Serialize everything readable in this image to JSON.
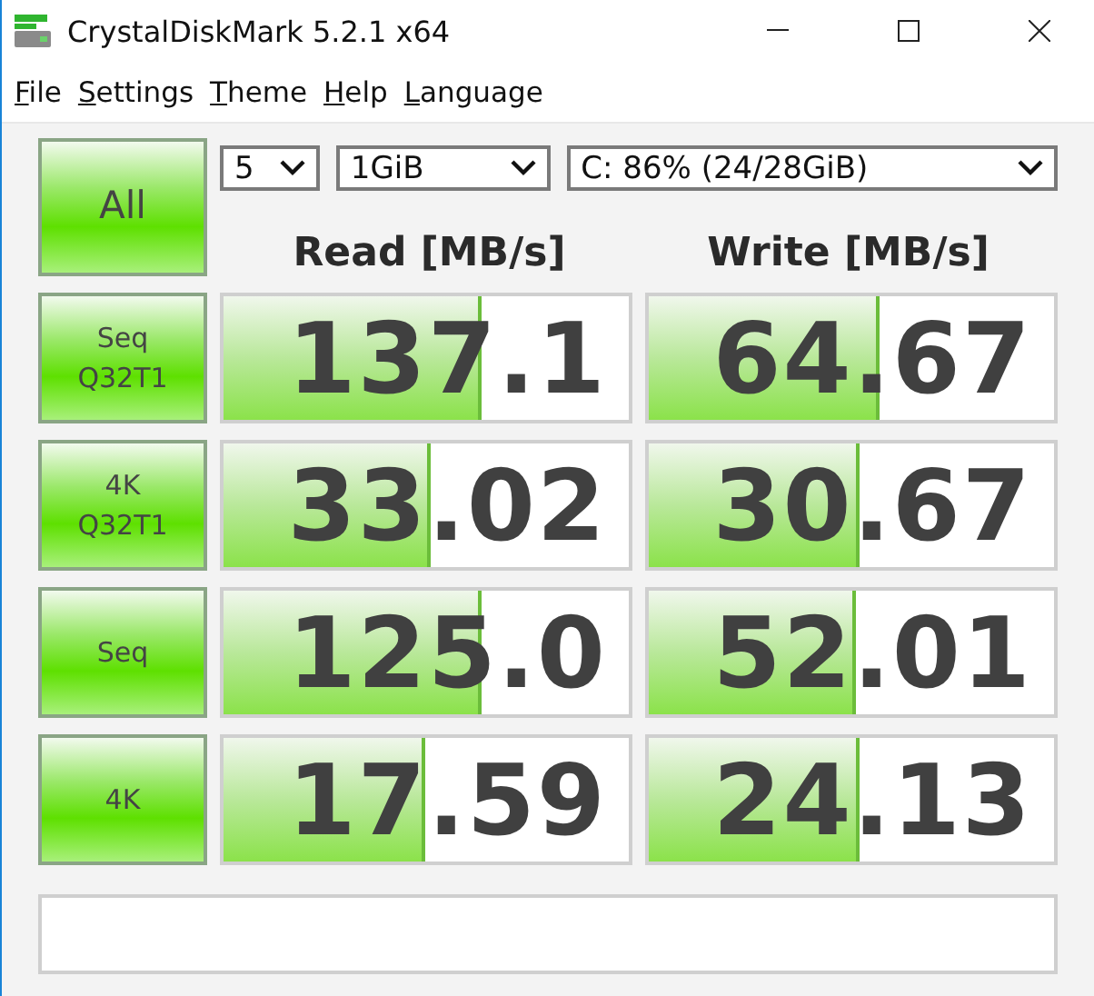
{
  "window": {
    "title": "CrystalDiskMark 5.2.1 x64"
  },
  "menu": [
    {
      "label": "File"
    },
    {
      "label": "Settings"
    },
    {
      "label": "Theme"
    },
    {
      "label": "Help"
    },
    {
      "label": "Language"
    }
  ],
  "all_button": {
    "label": "All"
  },
  "controls": {
    "count": "5",
    "size": "1GiB",
    "drive": "C: 86% (24/28GiB)"
  },
  "columns": [
    "Read [MB/s]",
    "Write [MB/s]"
  ],
  "rows": [
    {
      "label": "Seq\nQ32T1",
      "read": {
        "value": "137.1",
        "level": 0.63
      },
      "write": {
        "value": "64.67",
        "level": 0.56
      }
    },
    {
      "label": "4K\nQ32T1",
      "read": {
        "value": "33.02",
        "level": 0.5
      },
      "write": {
        "value": "30.67",
        "level": 0.51
      }
    },
    {
      "label": "Seq",
      "read": {
        "value": "125.0",
        "level": 0.63
      },
      "write": {
        "value": "52.01",
        "level": 0.5
      }
    },
    {
      "label": "4K",
      "read": {
        "value": "17.59",
        "level": 0.49
      },
      "write": {
        "value": "24.13",
        "level": 0.51
      }
    }
  ]
}
